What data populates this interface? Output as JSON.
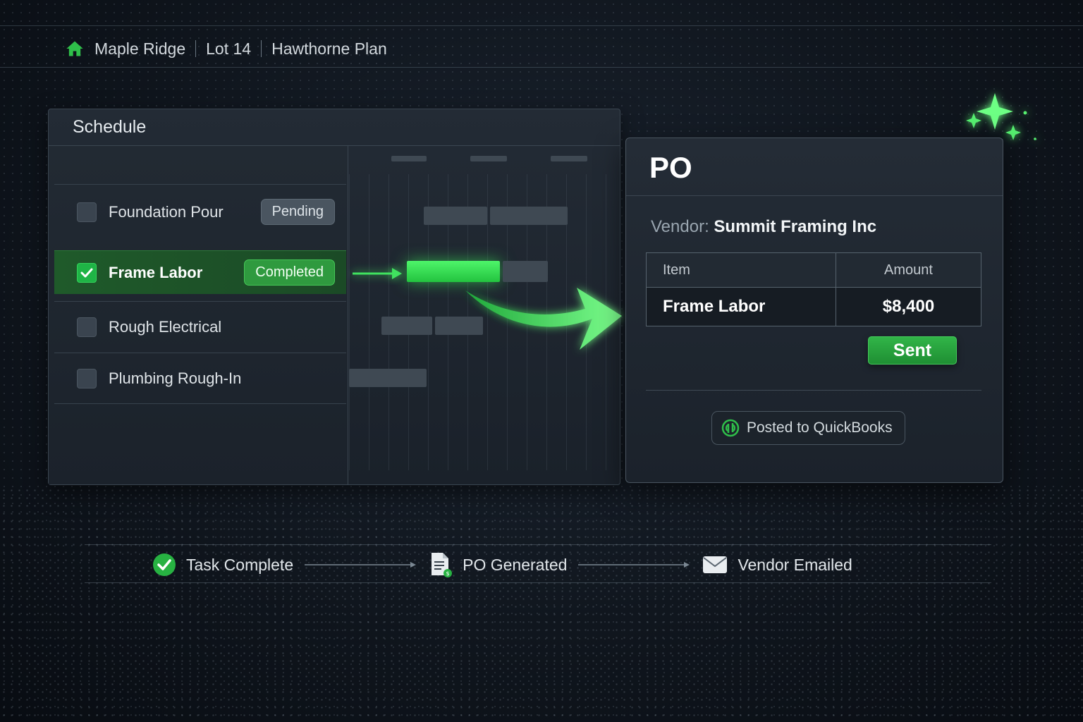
{
  "breadcrumb": {
    "items": [
      "Maple Ridge",
      "Lot 14",
      "Hawthorne Plan"
    ],
    "icon": "home-icon"
  },
  "schedule": {
    "title": "Schedule",
    "tasks": [
      {
        "label": "Foundation Pour",
        "checked": false,
        "status": "Pending"
      },
      {
        "label": "Frame Labor",
        "checked": true,
        "status": "Completed"
      },
      {
        "label": "Rough Electrical",
        "checked": false,
        "status": ""
      },
      {
        "label": "Plumbing Rough-In",
        "checked": false,
        "status": ""
      }
    ]
  },
  "po": {
    "title": "PO",
    "vendor_label": "Vendor:",
    "vendor_name": "Summit Framing Inc",
    "table": {
      "headers": [
        "Item",
        "Amount"
      ],
      "rows": [
        [
          "Frame Labor",
          "$8,400"
        ]
      ]
    },
    "status_button": "Sent",
    "integration": "Posted to QuickBooks"
  },
  "workflow": {
    "steps": [
      "Task Complete",
      "PO Generated",
      "Vendor Emailed"
    ]
  },
  "colors": {
    "accent_green": "#2fbf4a",
    "glow_green": "#4ef56a",
    "background": "#10161e",
    "panel": "#1f2730"
  }
}
